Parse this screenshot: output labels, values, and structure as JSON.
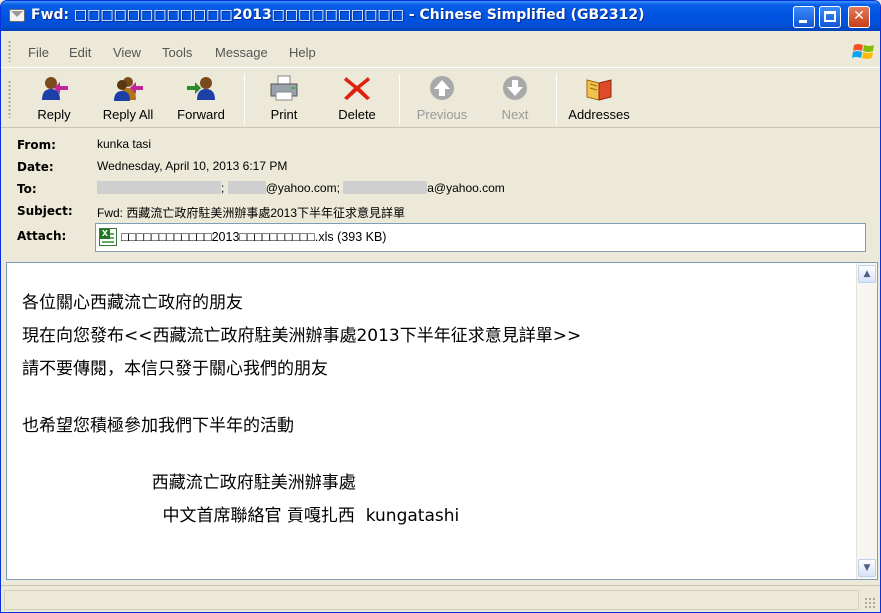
{
  "window": {
    "title": "Fwd: □□□□□□□□□□□□2013□□□□□□□□□□ - Chinese Simplified (GB2312)"
  },
  "menu": {
    "items": [
      "File",
      "Edit",
      "View",
      "Tools",
      "Message",
      "Help"
    ]
  },
  "toolbar": {
    "reply": "Reply",
    "reply_all": "Reply All",
    "forward": "Forward",
    "print": "Print",
    "delete": "Delete",
    "previous": "Previous",
    "next": "Next",
    "addresses": "Addresses"
  },
  "headers": {
    "from_label": "From:",
    "from_value": "kunka tasi",
    "date_label": "Date:",
    "date_value": "Wednesday, April 10, 2013 6:17 PM",
    "to_label": "To:",
    "to_part1": ";",
    "to_part2": "@yahoo.com;",
    "to_part3": "a@yahoo.com",
    "subject_label": "Subject:",
    "subject_value": "Fwd: 西藏流亡政府駐美洲辦事處2013下半年征求意見詳單",
    "attach_label": "Attach:",
    "attach_value": "□□□□□□□□□□□□2013□□□□□□□□□□.xls (393 KB)"
  },
  "body": {
    "lines": [
      "各位關心西藏流亡政府的朋友",
      "現在向您發布<<西藏流亡政府駐美洲辦事處2013下半年征求意見詳單>>",
      "請不要傳閱，本信只發于關心我們的朋友",
      "",
      "也希望您積極參加我們下半年的活動",
      "",
      "                        西藏流亡政府駐美洲辦事處",
      "                          中文首席聯絡官 貢嘎扎西  kungatashi"
    ]
  },
  "colors": {
    "titlebar": "#0054E3",
    "chrome": "#ECE9D8",
    "delete_red": "#E02010"
  }
}
